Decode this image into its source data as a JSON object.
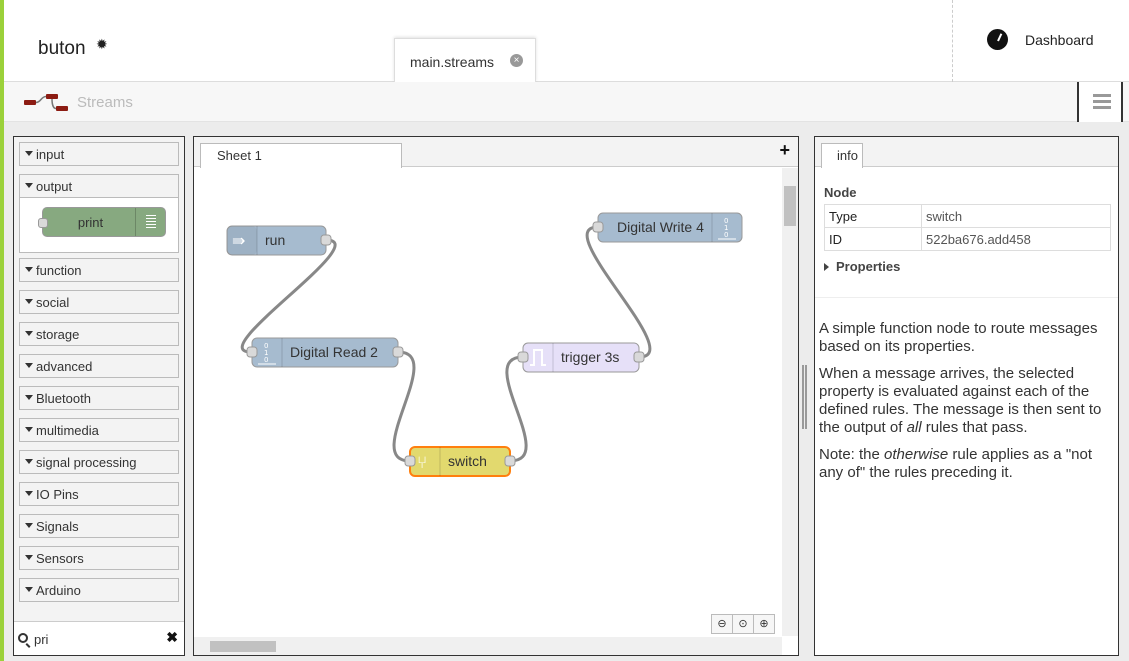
{
  "app": {
    "title": "buton"
  },
  "tabs": [
    {
      "label": "main.streams"
    }
  ],
  "dashboard": {
    "label": "Dashboard"
  },
  "header": {
    "title": "Streams"
  },
  "palette": {
    "categories": [
      {
        "label": "input"
      },
      {
        "label": "output"
      },
      {
        "label": "function"
      },
      {
        "label": "social"
      },
      {
        "label": "storage"
      },
      {
        "label": "advanced"
      },
      {
        "label": "Bluetooth"
      },
      {
        "label": "multimedia"
      },
      {
        "label": "signal processing"
      },
      {
        "label": "IO Pins"
      },
      {
        "label": "Signals"
      },
      {
        "label": "Sensors"
      },
      {
        "label": "Arduino"
      }
    ],
    "output_nodes": [
      {
        "label": "print",
        "color": "#87a980"
      }
    ],
    "search": {
      "value": "pri"
    }
  },
  "canvas": {
    "sheet_tab": "Sheet 1",
    "add_symbol": "+",
    "nodes": [
      {
        "label": "run",
        "color": "#a6bbcf"
      },
      {
        "label": "Digital Read 2",
        "color": "#a6bbcf"
      },
      {
        "label": "switch",
        "color": "#e2d96e"
      },
      {
        "label": "trigger 3s",
        "color": "#e6e0f8"
      },
      {
        "label": "Digital Write 4",
        "color": "#a6bbcf"
      }
    ]
  },
  "sidebar": {
    "tab": "info",
    "node_heading": "Node",
    "props": [
      {
        "key": "Type",
        "value": "switch"
      },
      {
        "key": "ID",
        "value": "522ba676.add458"
      }
    ],
    "properties_label": "Properties",
    "help": {
      "p1": "A simple function node to route messages based on its properties.",
      "p2_a": "When a message arrives, the selected property is evaluated against each of the defined rules. The message is then sent to the output of ",
      "p2_em": "all",
      "p2_b": " rules that pass.",
      "p3_a": "Note: the ",
      "p3_em": "otherwise",
      "p3_b": " rule applies as a \"not any of\" the rules preceding it."
    }
  },
  "colors": {
    "accent": "#9bd13a",
    "wire": "#888888"
  }
}
